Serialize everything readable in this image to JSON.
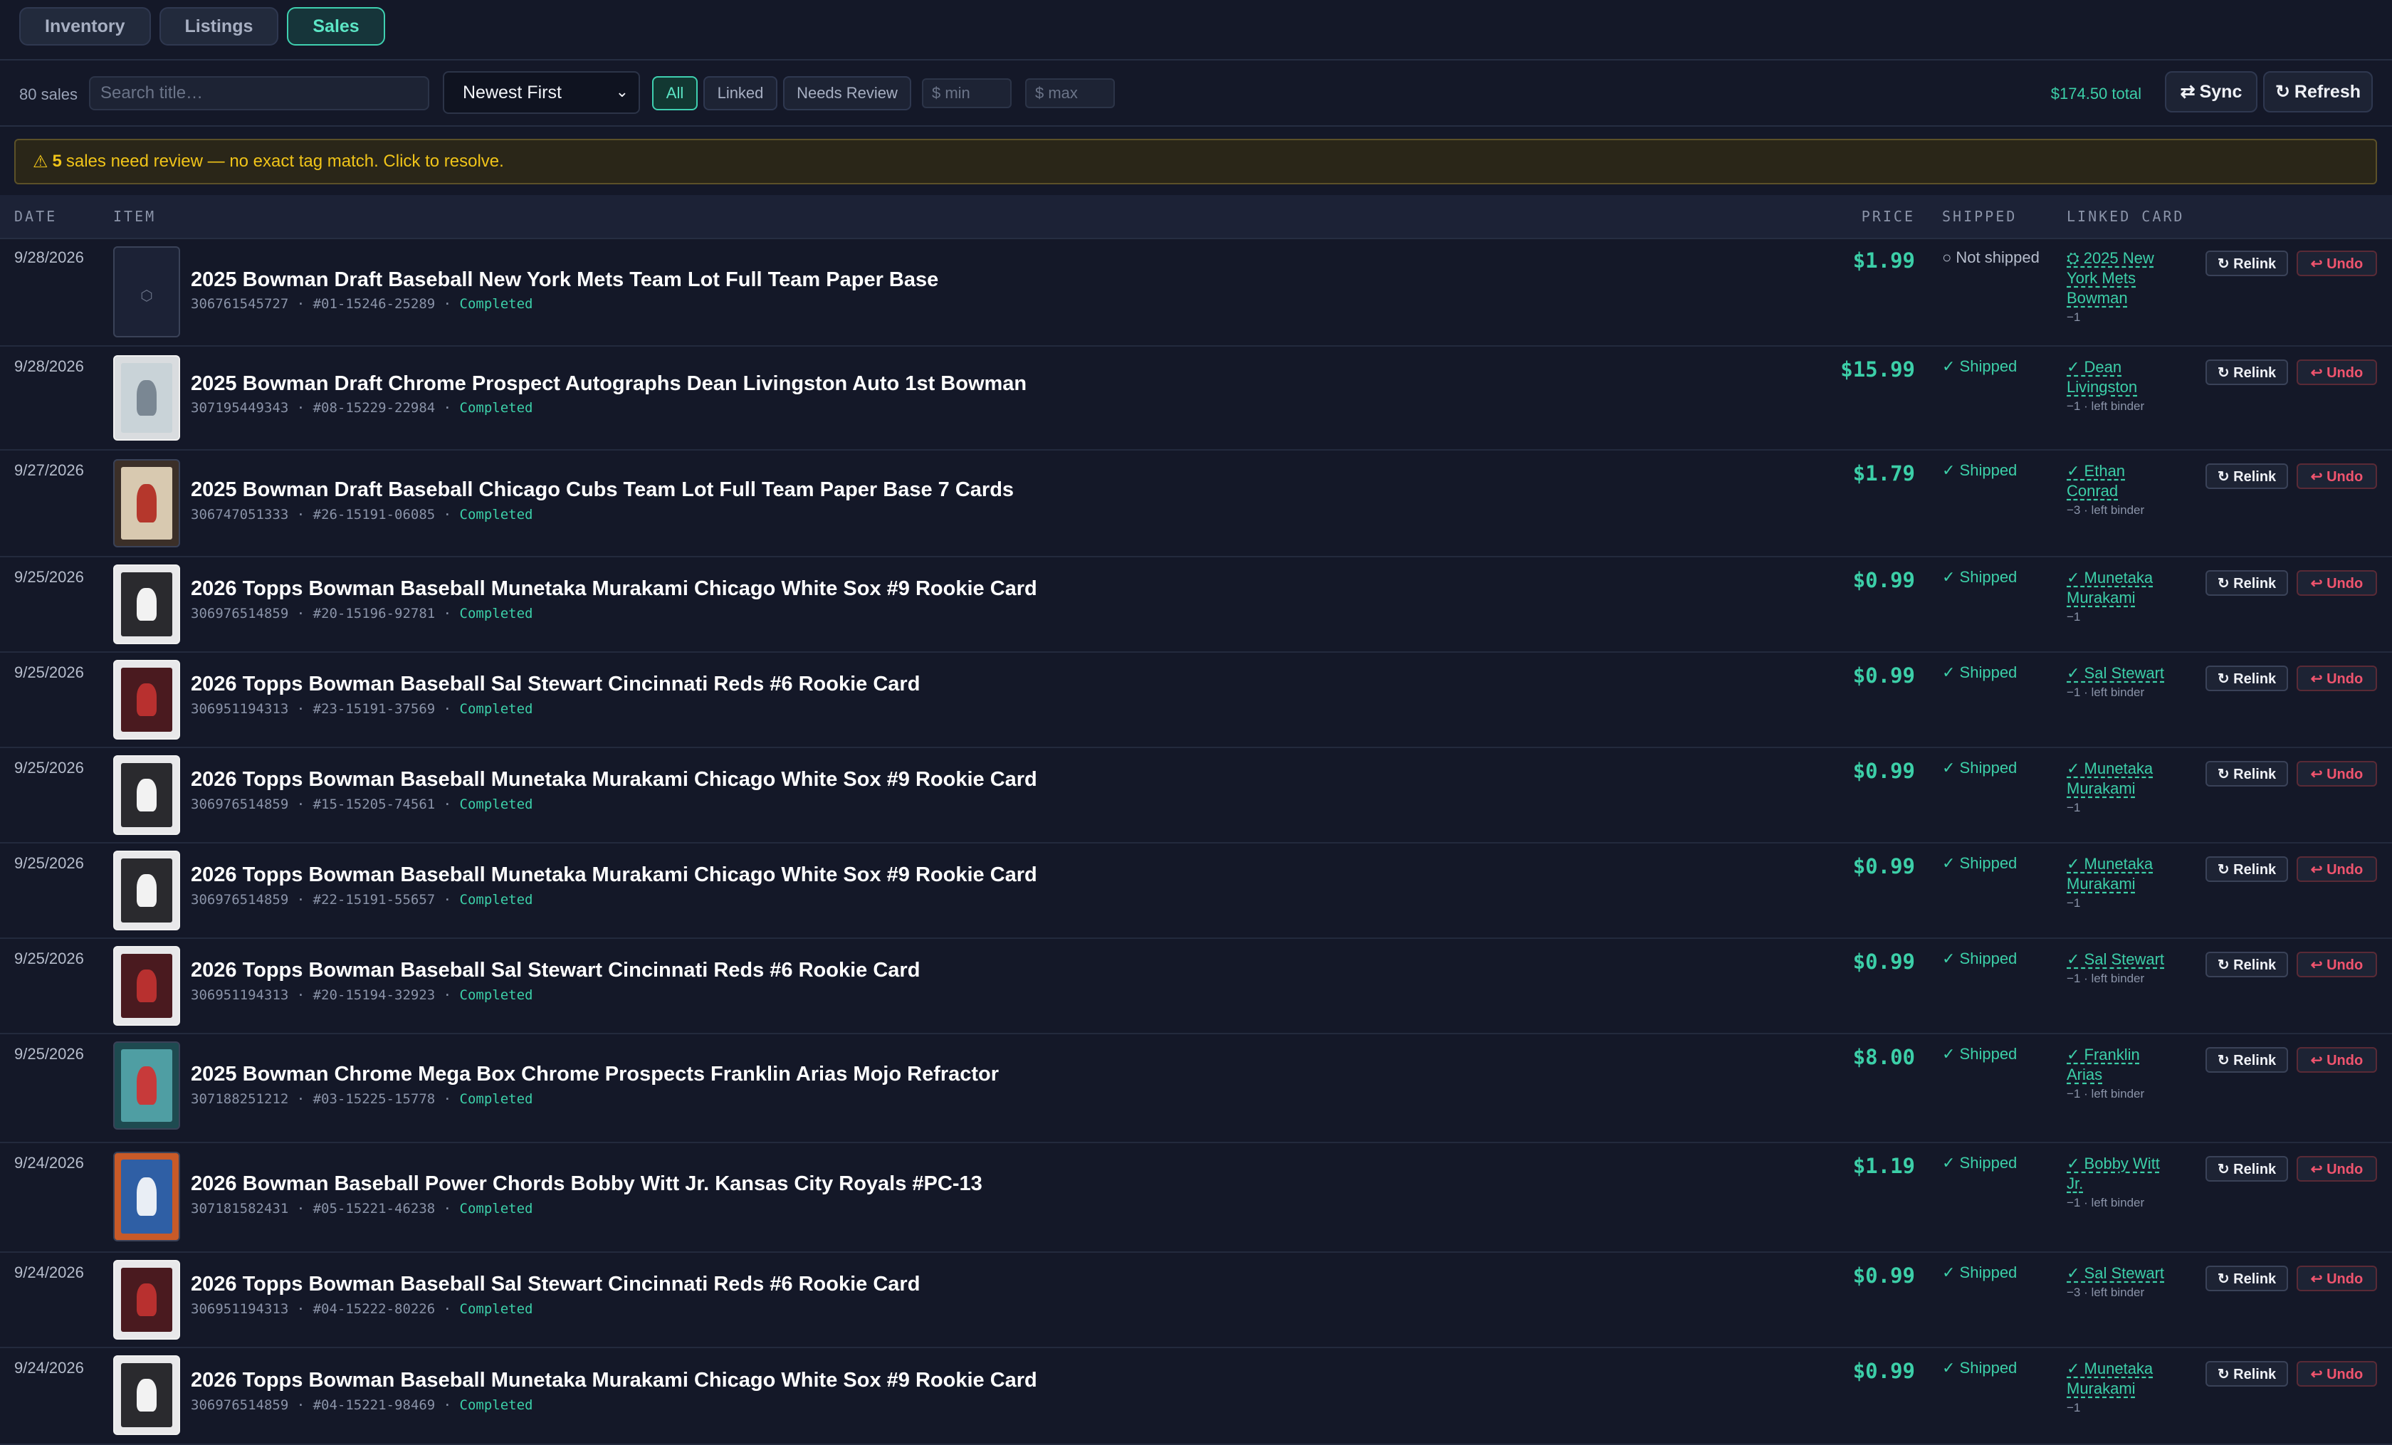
{
  "tabs": [
    {
      "label": "Inventory",
      "active": false
    },
    {
      "label": "Listings",
      "active": false
    },
    {
      "label": "Sales",
      "active": true
    }
  ],
  "toolbar": {
    "sales_count": "80 sales",
    "search_placeholder": "Search title…",
    "sort_value": "Newest First",
    "filters": [
      "All",
      "Linked",
      "Needs Review"
    ],
    "active_filter": "All",
    "min_placeholder": "$ min",
    "max_placeholder": "$ max",
    "total": "$174.50 total",
    "sync_label": "Sync",
    "refresh_label": "Refresh",
    "sync_icon": "⇄",
    "refresh_icon": "↻"
  },
  "warning": {
    "icon": "⚠",
    "count": "5",
    "text": "sales need review — no exact tag match. Click to resolve."
  },
  "columns": {
    "date": "DATE",
    "item": "ITEM",
    "price": "PRICE",
    "shipped": "SHIPPED",
    "linked": "LINKED CARD"
  },
  "colors": {
    "accent": "#3ccfa8",
    "warning": "#f0c419",
    "danger": "#f0546e",
    "background": "#141828"
  },
  "row_buttons": {
    "relink": "↻ Relink",
    "undo": "↩ Undo"
  },
  "rows": [
    {
      "date": "9/28/2026",
      "title": "2025 Bowman Draft Baseball New York Mets Team Lot Full Team Paper Base",
      "item_id": "306761545727",
      "sku": "#01-15246-25289",
      "status": "Completed",
      "price": "$1.99",
      "shipped": "○ Not shipped",
      "shipped_state": "not",
      "linked": "⛭ 2025 New York Mets Bowman",
      "linked_sub": "−1",
      "thumb": "placeholder"
    },
    {
      "date": "9/28/2026",
      "title": "2025 Bowman Draft Chrome Prospect Autographs Dean Livingston Auto 1st Bowman",
      "item_id": "307195449343",
      "sku": "#08-15229-22984",
      "status": "Completed",
      "price": "$15.99",
      "shipped": "✓ Shipped",
      "shipped_state": "yes",
      "linked": "✓ Dean Livingston",
      "linked_sub": "−1 · left binder",
      "thumb": "slab"
    },
    {
      "date": "9/27/2026",
      "title": "2025 Bowman Draft Baseball Chicago Cubs Team Lot Full Team Paper Base 7 Cards",
      "item_id": "306747051333",
      "sku": "#26-15191-06085",
      "status": "Completed",
      "price": "$1.79",
      "shipped": "✓ Shipped",
      "shipped_state": "yes",
      "linked": "✓ Ethan Conrad",
      "linked_sub": "−3 · left binder",
      "thumb": "cubs"
    },
    {
      "date": "9/25/2026",
      "title": "2026 Topps Bowman Baseball Munetaka Murakami Chicago White Sox #9 Rookie Card",
      "item_id": "306976514859",
      "sku": "#20-15196-92781",
      "status": "Completed",
      "price": "$0.99",
      "shipped": "✓ Shipped",
      "shipped_state": "yes",
      "linked": "✓ Munetaka Murakami",
      "linked_sub": "−1",
      "thumb": "sox"
    },
    {
      "date": "9/25/2026",
      "title": "2026 Topps Bowman Baseball Sal Stewart Cincinnati Reds #6 Rookie Card",
      "item_id": "306951194313",
      "sku": "#23-15191-37569",
      "status": "Completed",
      "price": "$0.99",
      "shipped": "✓ Shipped",
      "shipped_state": "yes",
      "linked": "✓ Sal Stewart",
      "linked_sub": "−1 · left binder",
      "thumb": "reds"
    },
    {
      "date": "9/25/2026",
      "title": "2026 Topps Bowman Baseball Munetaka Murakami Chicago White Sox #9 Rookie Card",
      "item_id": "306976514859",
      "sku": "#15-15205-74561",
      "status": "Completed",
      "price": "$0.99",
      "shipped": "✓ Shipped",
      "shipped_state": "yes",
      "linked": "✓ Munetaka Murakami",
      "linked_sub": "−1",
      "thumb": "sox"
    },
    {
      "date": "9/25/2026",
      "title": "2026 Topps Bowman Baseball Munetaka Murakami Chicago White Sox #9 Rookie Card",
      "item_id": "306976514859",
      "sku": "#22-15191-55657",
      "status": "Completed",
      "price": "$0.99",
      "shipped": "✓ Shipped",
      "shipped_state": "yes",
      "linked": "✓ Munetaka Murakami",
      "linked_sub": "−1",
      "thumb": "sox"
    },
    {
      "date": "9/25/2026",
      "title": "2026 Topps Bowman Baseball Sal Stewart Cincinnati Reds #6 Rookie Card",
      "item_id": "306951194313",
      "sku": "#20-15194-32923",
      "status": "Completed",
      "price": "$0.99",
      "shipped": "✓ Shipped",
      "shipped_state": "yes",
      "linked": "✓ Sal Stewart",
      "linked_sub": "−1 · left binder",
      "thumb": "reds"
    },
    {
      "date": "9/25/2026",
      "title": "2025 Bowman Chrome Mega Box Chrome Prospects Franklin Arias Mojo Refractor",
      "item_id": "307188251212",
      "sku": "#03-15225-15778",
      "status": "Completed",
      "price": "$8.00",
      "shipped": "✓ Shipped",
      "shipped_state": "yes",
      "linked": "✓ Franklin Arias",
      "linked_sub": "−1 · left binder",
      "thumb": "mojo"
    },
    {
      "date": "9/24/2026",
      "title": "2026 Bowman Baseball Power Chords Bobby Witt Jr. Kansas City Royals #PC-13",
      "item_id": "307181582431",
      "sku": "#05-15221-46238",
      "status": "Completed",
      "price": "$1.19",
      "shipped": "✓ Shipped",
      "shipped_state": "yes",
      "linked": "✓ Bobby Witt Jr.",
      "linked_sub": "−1 · left binder",
      "thumb": "royals"
    },
    {
      "date": "9/24/2026",
      "title": "2026 Topps Bowman Baseball Sal Stewart Cincinnati Reds #6 Rookie Card",
      "item_id": "306951194313",
      "sku": "#04-15222-80226",
      "status": "Completed",
      "price": "$0.99",
      "shipped": "✓ Shipped",
      "shipped_state": "yes",
      "linked": "✓ Sal Stewart",
      "linked_sub": "−3 · left binder",
      "thumb": "reds"
    },
    {
      "date": "9/24/2026",
      "title": "2026 Topps Bowman Baseball Munetaka Murakami Chicago White Sox #9 Rookie Card",
      "item_id": "306976514859",
      "sku": "#04-15221-98469",
      "status": "Completed",
      "price": "$0.99",
      "shipped": "✓ Shipped",
      "shipped_state": "yes",
      "linked": "✓ Munetaka Murakami",
      "linked_sub": "−1",
      "thumb": "sox"
    }
  ]
}
